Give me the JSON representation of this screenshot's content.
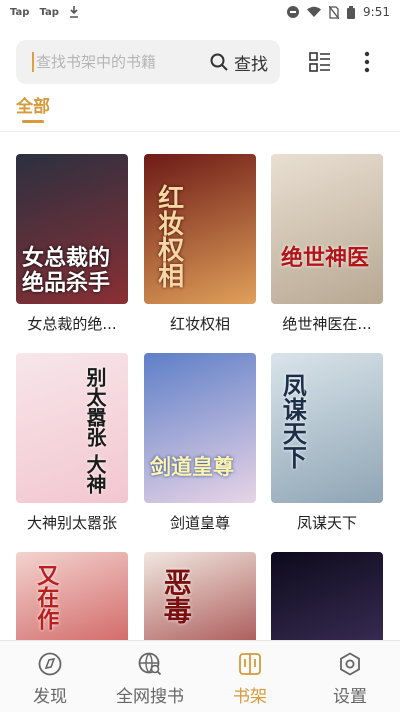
{
  "status_bar": {
    "left_items": [
      "Tap",
      "Tap"
    ],
    "time": "9:51"
  },
  "search": {
    "placeholder": "查找书架中的书籍",
    "button_label": "查找"
  },
  "tabs": [
    {
      "label": "全部",
      "active": true
    }
  ],
  "books": [
    {
      "title": "女总裁的绝...",
      "cover_text": "女总裁的绝品杀手",
      "cover_colors": [
        "#2b3040",
        "#8a2f35"
      ]
    },
    {
      "title": "红妆权相",
      "cover_text": "红妆权相",
      "cover_colors": [
        "#6d1a16",
        "#e0a05a"
      ]
    },
    {
      "title": "绝世神医在...",
      "cover_text": "绝世神医",
      "cover_colors": [
        "#e9dfd2",
        "#b7a892"
      ]
    },
    {
      "title": "大神别太嚣张",
      "cover_text": "别太嚣张 大神",
      "cover_colors": [
        "#f7e6ea",
        "#f3c6d0"
      ]
    },
    {
      "title": "剑道皇尊",
      "cover_text": "剑道皇尊",
      "cover_colors": [
        "#5e7fc8",
        "#e8d4e6"
      ]
    },
    {
      "title": "凤谋天下",
      "cover_text": "凤谋天下",
      "cover_colors": [
        "#d9e4ea",
        "#8fa5b5"
      ]
    },
    {
      "title": "",
      "cover_text": "又在作",
      "cover_colors": [
        "#f3d3cf",
        "#c33b3b"
      ]
    },
    {
      "title": "",
      "cover_text": "恶毒",
      "cover_colors": [
        "#f1e7e0",
        "#8e1f1f"
      ]
    },
    {
      "title": "",
      "cover_text": "",
      "cover_colors": [
        "#0d0a1c",
        "#4a3a6a"
      ]
    }
  ],
  "bottom_nav": [
    {
      "label": "发现",
      "icon": "compass-icon",
      "active": false
    },
    {
      "label": "全网搜书",
      "icon": "globe-search-icon",
      "active": false
    },
    {
      "label": "书架",
      "icon": "bookshelf-icon",
      "active": true
    },
    {
      "label": "设置",
      "icon": "gear-icon",
      "active": false
    }
  ],
  "colors": {
    "accent": "#d69a3a",
    "search_bg": "#f1f1f1"
  }
}
